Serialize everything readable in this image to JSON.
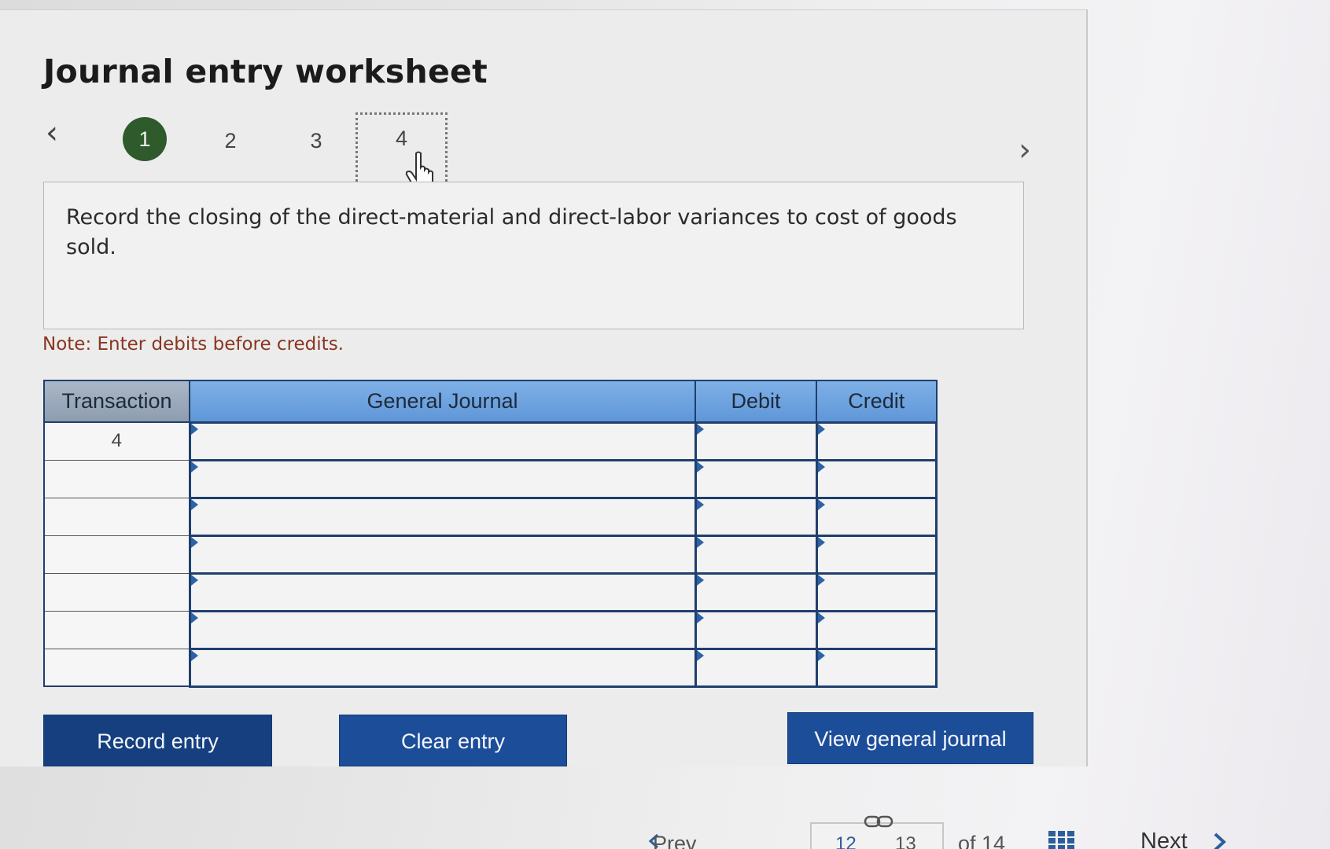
{
  "worksheet": {
    "title": "Journal entry worksheet",
    "steps": [
      "1",
      "2",
      "3",
      "4"
    ],
    "active_step": "1",
    "instruction": "Record the closing of the direct-material and direct-labor variances to cost of goods sold.",
    "note": "Note: Enter debits before credits."
  },
  "table": {
    "headers": {
      "transaction": "Transaction",
      "journal": "General Journal",
      "debit": "Debit",
      "credit": "Credit"
    },
    "rows": [
      {
        "transaction": "4"
      },
      {
        "transaction": ""
      },
      {
        "transaction": ""
      },
      {
        "transaction": ""
      },
      {
        "transaction": ""
      },
      {
        "transaction": ""
      },
      {
        "transaction": ""
      }
    ]
  },
  "buttons": {
    "record": "Record entry",
    "clear": "Clear entry",
    "view": "View general journal"
  },
  "footer": {
    "prev_label": "Prev",
    "page_prev": "12",
    "page_current": "13",
    "page_total": "of 14",
    "next_label": "Next"
  },
  "colors": {
    "header_blue": "#6fa3df",
    "button_blue": "#1c4d99",
    "active_step": "#2e5a2c",
    "note_red": "#8a3520"
  }
}
